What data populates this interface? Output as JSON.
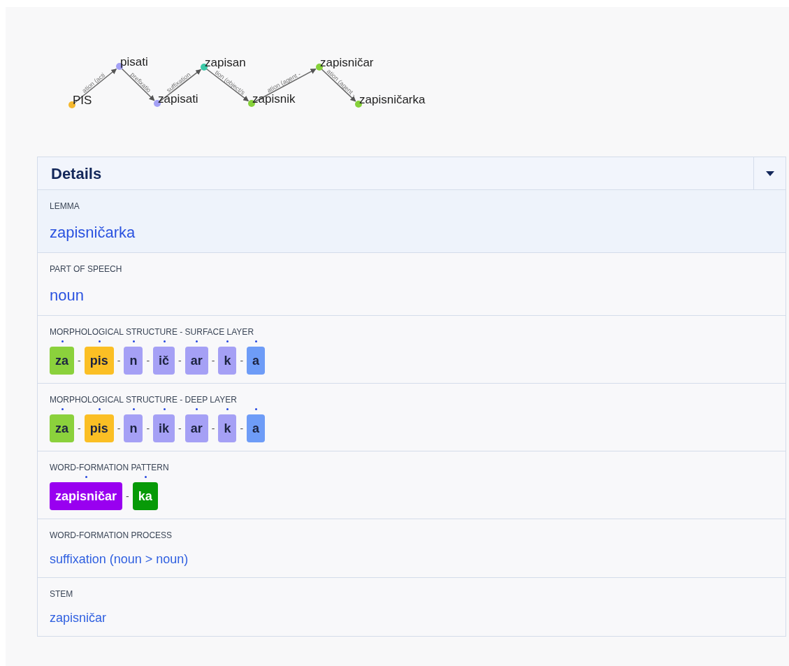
{
  "graph": {
    "nodes": [
      {
        "label": "PIS",
        "color": "#f5b82e"
      },
      {
        "label": "pisati",
        "color": "#a3a0f5"
      },
      {
        "label": "zapisati",
        "color": "#a3a0f5"
      },
      {
        "label": "zapisan",
        "color": "#3cc9a8"
      },
      {
        "label": "zapisnik",
        "color": "#86d13a"
      },
      {
        "label": "zapisničar",
        "color": "#86d13a"
      },
      {
        "label": "zapisničarka",
        "color": "#86d13a"
      }
    ],
    "edges": [
      {
        "label": "ation (acti"
      },
      {
        "label": "prefixatio"
      },
      {
        "label": "suffixation"
      },
      {
        "label": "tion (object/s"
      },
      {
        "label": "ation (agent -"
      },
      {
        "label": "ation (agent -"
      }
    ]
  },
  "details": {
    "title": "Details",
    "expanded": true,
    "rows": [
      {
        "label": "LEMMA",
        "kind": "large",
        "selected": true,
        "value": "zapisničarka"
      },
      {
        "label": "PART OF SPEECH",
        "kind": "large",
        "selected": false,
        "value": "noun"
      },
      {
        "label": "MORPHOLOGICAL STRUCTURE - SURFACE LAYER",
        "kind": "morphemes",
        "selected": false,
        "morphemes": [
          {
            "text": "za",
            "color": "#8bd13c"
          },
          {
            "sep": "-",
            "text": "pis",
            "color": "#fbbf24"
          },
          {
            "sep": "-",
            "text": "n",
            "color": "#a5a0f5"
          },
          {
            "sep": "-",
            "text": "ič",
            "color": "#a5a0f5"
          },
          {
            "sep": "-",
            "text": "ar",
            "color": "#a5a0f5"
          },
          {
            "sep": "-",
            "text": "k",
            "color": "#a5a0f5"
          },
          {
            "sep": "-",
            "text": "a",
            "color": "#6e9cf7"
          }
        ]
      },
      {
        "label": "MORPHOLOGICAL STRUCTURE - DEEP LAYER",
        "kind": "morphemes",
        "selected": false,
        "morphemes": [
          {
            "text": "za",
            "color": "#8bd13c"
          },
          {
            "sep": "-",
            "text": "pis",
            "color": "#fbbf24"
          },
          {
            "sep": "-",
            "text": "n",
            "color": "#a5a0f5"
          },
          {
            "sep": "-",
            "text": "ik",
            "color": "#a5a0f5"
          },
          {
            "sep": "-",
            "text": "ar",
            "color": "#a5a0f5"
          },
          {
            "sep": "-",
            "text": "k",
            "color": "#a5a0f5"
          },
          {
            "sep": "-",
            "text": "a",
            "color": "#6e9cf7"
          }
        ]
      },
      {
        "label": "WORD-FORMATION PATTERN",
        "kind": "pattern",
        "selected": false,
        "morphemes": [
          {
            "text": "zapisničar",
            "color": "#9900f0"
          },
          {
            "sep": "-",
            "text": "ka",
            "color": "#079a07"
          }
        ]
      },
      {
        "label": "WORD-FORMATION PROCESS",
        "kind": "small",
        "selected": false,
        "value": "suffixation (noun > noun)"
      },
      {
        "label": "STEM",
        "kind": "small",
        "selected": false,
        "value": "zapisničar"
      }
    ]
  }
}
